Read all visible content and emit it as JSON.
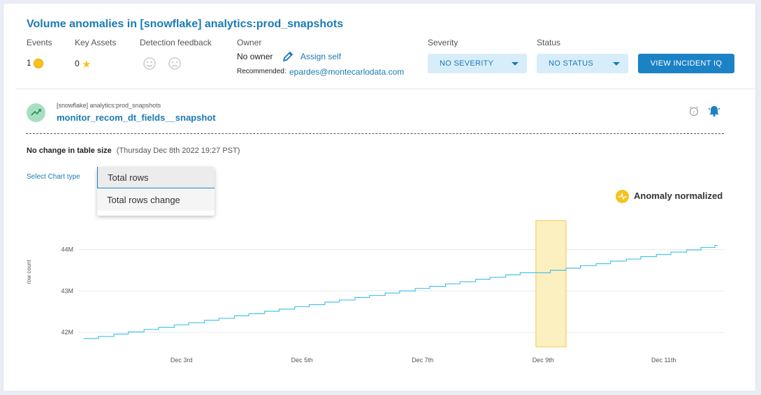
{
  "header": {
    "title": "Volume anomalies in [snowflake] analytics:prod_snapshots",
    "events_label": "Events",
    "events_value": "1",
    "key_assets_label": "Key Assets",
    "key_assets_value": "0",
    "feedback_label": "Detection feedback",
    "owner_label": "Owner",
    "owner_value": "No owner",
    "assign_label": "Assign self",
    "recommended_label": "Recommended:",
    "recommended_email": "epardes@montecarlodata.com",
    "severity_label": "Severity",
    "severity_value": "NO SEVERITY",
    "status_label": "Status",
    "status_value": "NO STATUS",
    "incident_button": "VIEW INCIDENT IQ"
  },
  "monitor": {
    "table": "[snowflake] analytics:prod_snapshots",
    "name": "monitor_recom_dt_fields__snapshot"
  },
  "summary": {
    "headline": "No change in table size",
    "timestamp": "(Thursday Dec 8th 2022 19:27 PST)"
  },
  "chart_type": {
    "label": "Select Chart type",
    "options": [
      "Total rows",
      "Total rows change"
    ],
    "selected": "Total rows"
  },
  "legend": {
    "anomaly_label": "Anomaly normalized",
    "anomaly_color": "#f7c21a"
  },
  "colors": {
    "accent": "#1b7ab3",
    "line": "#4cc3ec",
    "anomaly_fill": "#fcefc0",
    "anomaly_stroke": "#f0c850"
  },
  "chart_data": {
    "type": "line",
    "ylabel": "row count",
    "xlabel": "",
    "y_ticks": [
      42,
      43,
      44
    ],
    "y_tick_labels": [
      "42M",
      "43M",
      "44M"
    ],
    "x_ticks": [
      3,
      5,
      7,
      9,
      11
    ],
    "x_tick_labels": [
      "Dec 3rd",
      "Dec 5th",
      "Dec 7th",
      "Dec 9th",
      "Dec 11th"
    ],
    "x_range": [
      1.3,
      12.0
    ],
    "ylim": [
      41.65,
      44.7
    ],
    "series": [
      {
        "x": [
          1.38,
          1.62,
          1.88,
          2.12,
          2.38,
          2.62,
          2.88,
          3.12,
          3.38,
          3.62,
          3.88,
          4.12,
          4.38,
          4.62,
          4.88,
          5.12,
          5.38,
          5.62,
          5.88,
          6.12,
          6.38,
          6.62,
          6.88,
          7.12,
          7.38,
          7.62,
          7.88,
          8.12,
          8.38,
          8.62,
          8.88,
          9.12,
          9.38,
          9.62,
          9.88,
          10.12,
          10.38,
          10.62,
          10.88,
          11.12,
          11.38,
          11.62,
          11.85
        ],
        "y": [
          41.85,
          41.9,
          41.96,
          42.01,
          42.07,
          42.12,
          42.18,
          42.23,
          42.29,
          42.34,
          42.4,
          42.45,
          42.51,
          42.56,
          42.62,
          42.67,
          42.73,
          42.78,
          42.84,
          42.89,
          42.95,
          43.0,
          43.06,
          43.11,
          43.17,
          43.22,
          43.28,
          43.33,
          43.39,
          43.44,
          43.44,
          43.5,
          43.55,
          43.61,
          43.66,
          43.72,
          43.77,
          43.83,
          43.88,
          43.94,
          43.99,
          44.05,
          44.1
        ]
      }
    ],
    "anomaly_window": [
      8.88,
      9.38
    ]
  }
}
